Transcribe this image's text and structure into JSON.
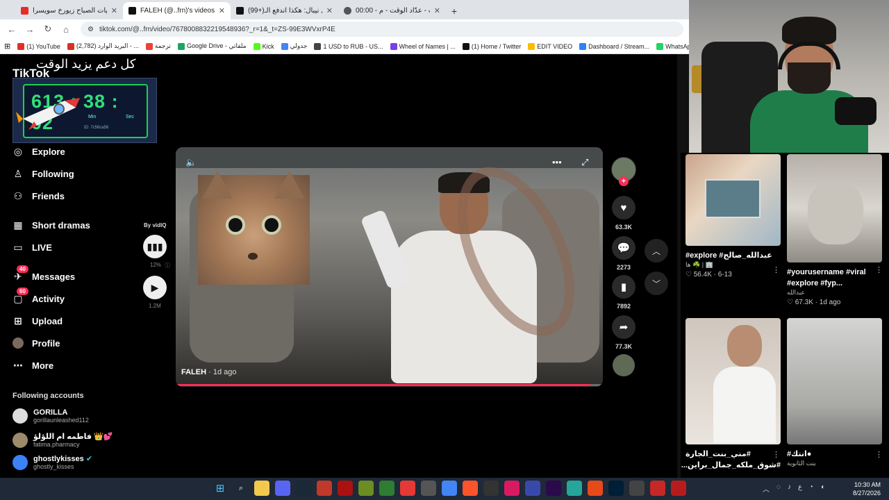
{
  "browser": {
    "tabs": [
      {
        "title": "فيروزيات الصباح زيورخ سويسرا",
        "favicon_color": "#e52d27",
        "active": false
      },
      {
        "title": "FALEH (@..frn)'s videos with ...",
        "favicon_color": "#111111",
        "active": true
      },
      {
        "title": "(99+)فيصل نيبال: هكذا اندفع الـ",
        "favicon_color": "#111111",
        "active": false
      },
      {
        "title": "00:00 - المؤقت - عدّاد الوقت - م",
        "favicon_color": "#555555",
        "active": false
      }
    ],
    "new_tab": "+",
    "url": "tiktok.com/@..frn/video/7678008832219548936?_r=1&_t=ZS-99E3WVxrP4E",
    "bookmarks": [
      {
        "label": "(1) YouTube",
        "color": "#e52d27"
      },
      {
        "label": "(2,782) البريد الوارد - ...",
        "color": "#d93025"
      },
      {
        "label": "ترجمة",
        "color": "#ea4335"
      },
      {
        "label": "Google Drive - ملفاتي",
        "color": "#1fa463"
      },
      {
        "label": "Kick",
        "color": "#53fc18"
      },
      {
        "label": "جدولي",
        "color": "#4285f4"
      },
      {
        "label": "1 USD to RUB - US...",
        "color": "#444444"
      },
      {
        "label": "Wheel of Names | ...",
        "color": "#7b3fe4"
      },
      {
        "label": "(1) Home / Twitter",
        "color": "#111111"
      },
      {
        "label": "EDIT VIDEO",
        "color": "#fbbc04"
      },
      {
        "label": "Dashboard / Stream...",
        "color": "#2f81f7"
      },
      {
        "label": "WhatsApp",
        "color": "#25d366"
      },
      {
        "label": "D",
        "color": "#4a6cf7"
      }
    ]
  },
  "overlay": {
    "banner": "كل دعم يزيد الوقت",
    "timer": "613 : 38 : 02",
    "timer_units": [
      "Min",
      "Sec"
    ],
    "timer_code": "ID: 7c56ca56"
  },
  "tiktok": {
    "logo": "TikTok",
    "nav": [
      {
        "label": "Explore",
        "icon": "compass-icon",
        "glyph": "◎"
      },
      {
        "label": "Following",
        "icon": "following-icon",
        "glyph": "♙"
      },
      {
        "label": "Friends",
        "icon": "friends-icon",
        "glyph": "⚇"
      },
      {
        "label": "Short dramas",
        "icon": "film-icon",
        "glyph": "▦"
      },
      {
        "label": "LIVE",
        "icon": "live-icon",
        "glyph": "▭"
      },
      {
        "label": "Messages",
        "icon": "messages-icon",
        "glyph": "✈",
        "badge": "40"
      },
      {
        "label": "Activity",
        "icon": "activity-icon",
        "glyph": "▢",
        "badge": "60"
      },
      {
        "label": "Upload",
        "icon": "upload-icon",
        "glyph": "⊞"
      },
      {
        "label": "Profile",
        "icon": "profile-avatar-icon",
        "glyph": "●"
      },
      {
        "label": "More",
        "icon": "more-icon",
        "glyph": "⋯"
      }
    ],
    "following_header": "Following accounts",
    "following": [
      {
        "name": "GORILLA",
        "handle": "gorillaunleashed112"
      },
      {
        "name": "فاطمه ام اللؤلؤ 👑💕",
        "handle": "fatima.pharmacy"
      },
      {
        "name": "ghostlykisses",
        "handle": "ghostly_kisses"
      }
    ],
    "video": {
      "author": "FALEH",
      "posted": "· 1d ago",
      "progress": 0.97
    },
    "vidiq": {
      "label": "By vidIQ",
      "percent": "12%",
      "views": "1.2M"
    },
    "actions": {
      "likes": "63.3K",
      "comments": "2273",
      "bookmarks": "7892",
      "shares": "77.3K"
    }
  },
  "feed": [
    {
      "desc": "#explore #عبدالله_صالح",
      "sub": "ها ☘️ | 🏢",
      "likes": "56.4K",
      "date": "6-13"
    },
    {
      "desc": "#yourusername #viral #explore #fyp...",
      "sub": "عبدالله",
      "likes": "67.3K",
      "date": "1d ago"
    },
    {
      "desc": "#مني_بنت_الجارة #شوق_ملكه_جمال_براين...",
      "sub": "",
      "likes": "",
      "date": ""
    },
    {
      "desc": "#انتك●",
      "sub": "بنت الثانوية",
      "likes": "",
      "date": ""
    }
  ],
  "taskbar": {
    "tray_lang": "ع",
    "time": "10:30 AM",
    "date": "8/27/2026"
  }
}
